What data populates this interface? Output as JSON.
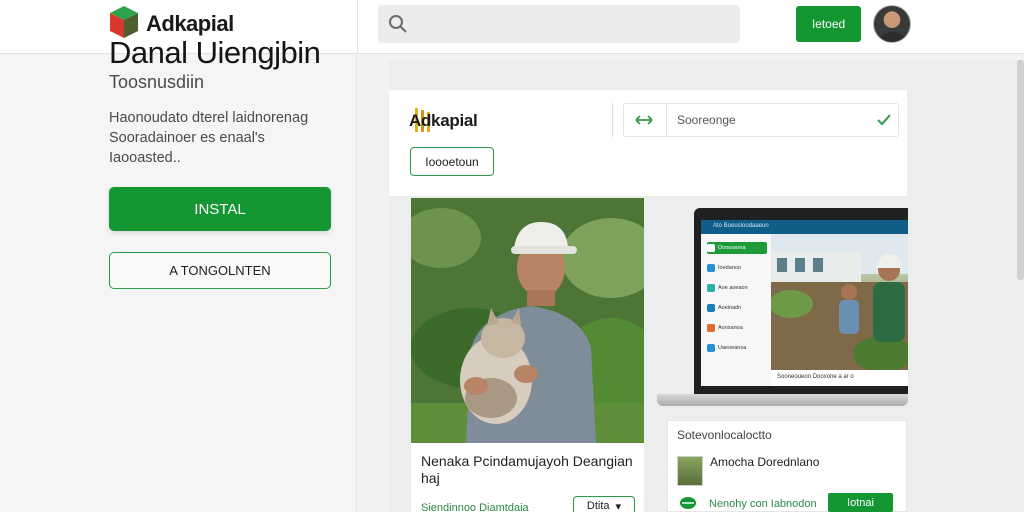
{
  "header": {
    "brand": "Adkapial",
    "search_placeholder": "",
    "action_label": "Ietoed",
    "logo_icon": "cube-logo-icon",
    "search_icon": "search-icon",
    "avatar_icon": "user-avatar"
  },
  "hero": {
    "title": "Danal Uiengjbin",
    "subtitle": "Toosnusdiin",
    "description": "Haonoudato dterel laidnorenag Sooradainoer es enaal's Iaooasted..",
    "install_label": "INSTAL",
    "secondary_label": "A TONGOLNTEN"
  },
  "card": {
    "brand": "Adkapial",
    "control_value": "Sooreonge",
    "button_label": "Ioooetoun",
    "arrows_icon": "swap-arrows-icon",
    "check_icon": "check-icon"
  },
  "photo_card": {
    "caption": "Nenaka Pcindamujayoh Deangian haj",
    "footer_link": "Siendinnoo Diamtdaia",
    "footer_button": "Dtita"
  },
  "laptop": {
    "header_text": "Ato Boeusloodaaeun",
    "sidebar_items": [
      "Ooouoaroa",
      "Ioedanoo",
      "Aoe aoeaon",
      "Aoeinadn",
      "Aonsanoa",
      "Uaeoeanoa"
    ],
    "strip_text": "Sooneoueon Dooxone a ar o"
  },
  "panel": {
    "title": "Sotevonlocaloctto",
    "item_text": "Amocha Dorednlano",
    "link_text": "Nenohy con Iabnodon",
    "button_label": "Iotnai",
    "leaf_icon": "leaf-icon"
  },
  "colors": {
    "accent_green": "#149632",
    "outline_green": "#2f9a4a"
  }
}
